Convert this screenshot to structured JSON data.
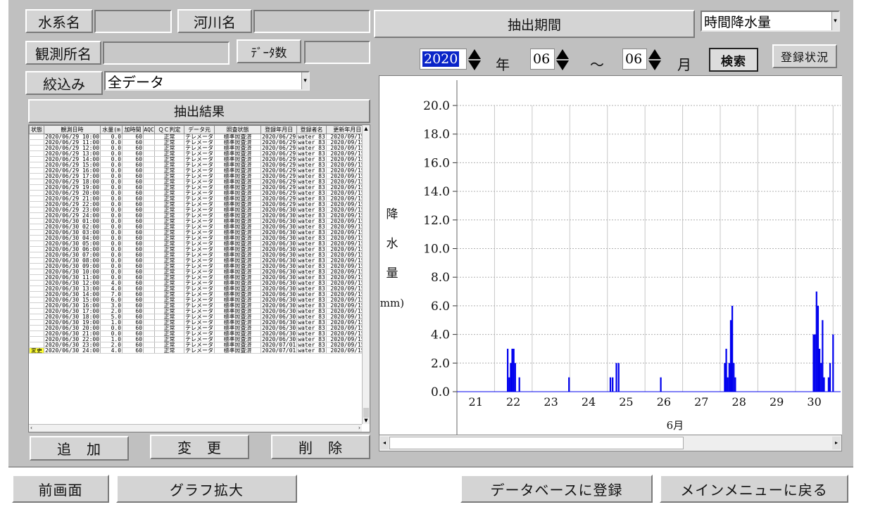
{
  "header": {
    "river_system_label": "水系名",
    "river_system_value": "",
    "river_label": "河川名",
    "river_value": "",
    "station_label": "観測所名",
    "station_value": "",
    "count_label": "ﾃﾞｰﾀ数",
    "count_value": "",
    "filter_label": "絞込み",
    "filter_value": "全データ",
    "result_title": "抽出結果"
  },
  "period": {
    "title": "抽出期間",
    "type_value": "時間降水量",
    "year": "2020",
    "year_unit": "年",
    "month_from": "06",
    "tilde": "～",
    "month_to": "06",
    "month_unit": "月",
    "search_button": "検索",
    "status_button": "登録状況"
  },
  "table": {
    "columns": [
      "状態",
      "観測日時",
      "水量(m",
      "加時間",
      "AQC",
      "ＱＣ判定",
      "データ元",
      "照査状態",
      "登録年月日",
      "登録者名",
      "更新年月日"
    ],
    "rows": [
      [
        "",
        "2020/06/29 10:00",
        "0.0",
        "60",
        "",
        "正常",
        "テレメータ",
        "標準照査済",
        "2020/06/29",
        "water_83",
        "2020/09/15"
      ],
      [
        "",
        "2020/06/29 11:00",
        "0.0",
        "60",
        "",
        "正常",
        "テレメータ",
        "標準照査済",
        "2020/06/29",
        "water_83",
        "2020/09/15"
      ],
      [
        "",
        "2020/06/29 12:00",
        "0.0",
        "60",
        "",
        "正常",
        "テレメータ",
        "標準照査済",
        "2020/06/29",
        "water_83",
        "2020/09/15"
      ],
      [
        "",
        "2020/06/29 13:00",
        "0.0",
        "60",
        "",
        "正常",
        "テレメータ",
        "標準照査済",
        "2020/06/29",
        "water_83",
        "2020/09/15"
      ],
      [
        "",
        "2020/06/29 14:00",
        "0.0",
        "60",
        "",
        "正常",
        "テレメータ",
        "標準照査済",
        "2020/06/29",
        "water_83",
        "2020/09/15"
      ],
      [
        "",
        "2020/06/29 15:00",
        "0.0",
        "60",
        "",
        "正常",
        "テレメータ",
        "標準照査済",
        "2020/06/29",
        "water_83",
        "2020/09/15"
      ],
      [
        "",
        "2020/06/29 16:00",
        "0.0",
        "60",
        "",
        "正常",
        "テレメータ",
        "標準照査済",
        "2020/06/29",
        "water_83",
        "2020/09/15"
      ],
      [
        "",
        "2020/06/29 17:00",
        "0.0",
        "60",
        "",
        "正常",
        "テレメータ",
        "標準照査済",
        "2020/06/29",
        "water_83",
        "2020/09/15"
      ],
      [
        "",
        "2020/06/29 18:00",
        "0.0",
        "60",
        "",
        "正常",
        "テレメータ",
        "標準照査済",
        "2020/06/29",
        "water_83",
        "2020/09/15"
      ],
      [
        "",
        "2020/06/29 19:00",
        "0.0",
        "60",
        "",
        "正常",
        "テレメータ",
        "標準照査済",
        "2020/06/29",
        "water_83",
        "2020/09/15"
      ],
      [
        "",
        "2020/06/29 20:00",
        "0.0",
        "60",
        "",
        "正常",
        "テレメータ",
        "標準照査済",
        "2020/06/29",
        "water_83",
        "2020/09/15"
      ],
      [
        "",
        "2020/06/29 21:00",
        "0.0",
        "60",
        "",
        "正常",
        "テレメータ",
        "標準照査済",
        "2020/06/29",
        "water_83",
        "2020/09/15"
      ],
      [
        "",
        "2020/06/29 22:00",
        "0.0",
        "60",
        "",
        "正常",
        "テレメータ",
        "標準照査済",
        "2020/06/29",
        "water_83",
        "2020/09/15"
      ],
      [
        "",
        "2020/06/29 23:00",
        "0.0",
        "60",
        "",
        "正常",
        "テレメータ",
        "標準照査済",
        "2020/06/30",
        "water_83",
        "2020/09/15"
      ],
      [
        "",
        "2020/06/29 24:00",
        "0.0",
        "60",
        "",
        "正常",
        "テレメータ",
        "標準照査済",
        "2020/06/30",
        "water_83",
        "2020/09/15"
      ],
      [
        "",
        "2020/06/30 01:00",
        "0.0",
        "60",
        "",
        "正常",
        "テレメータ",
        "標準照査済",
        "2020/06/30",
        "water_83",
        "2020/09/15"
      ],
      [
        "",
        "2020/06/30 02:00",
        "0.0",
        "60",
        "",
        "正常",
        "テレメータ",
        "標準照査済",
        "2020/06/30",
        "water_83",
        "2020/09/15"
      ],
      [
        "",
        "2020/06/30 03:00",
        "0.0",
        "60",
        "",
        "正常",
        "テレメータ",
        "標準照査済",
        "2020/06/30",
        "water_83",
        "2020/09/15"
      ],
      [
        "",
        "2020/06/30 04:00",
        "0.0",
        "60",
        "",
        "正常",
        "テレメータ",
        "標準照査済",
        "2020/06/30",
        "water_83",
        "2020/09/15"
      ],
      [
        "",
        "2020/06/30 05:00",
        "0.0",
        "60",
        "",
        "正常",
        "テレメータ",
        "標準照査済",
        "2020/06/30",
        "water_83",
        "2020/09/15"
      ],
      [
        "",
        "2020/06/30 06:00",
        "0.0",
        "60",
        "",
        "正常",
        "テレメータ",
        "標準照査済",
        "2020/06/30",
        "water_83",
        "2020/09/15"
      ],
      [
        "",
        "2020/06/30 07:00",
        "0.0",
        "60",
        "",
        "正常",
        "テレメータ",
        "標準照査済",
        "2020/06/30",
        "water_83",
        "2020/09/15"
      ],
      [
        "",
        "2020/06/30 08:00",
        "0.0",
        "60",
        "",
        "正常",
        "テレメータ",
        "標準照査済",
        "2020/06/30",
        "water_83",
        "2020/09/15"
      ],
      [
        "",
        "2020/06/30 09:00",
        "0.0",
        "60",
        "",
        "正常",
        "テレメータ",
        "標準照査済",
        "2020/06/30",
        "water_83",
        "2020/09/15"
      ],
      [
        "",
        "2020/06/30 10:00",
        "0.0",
        "60",
        "",
        "正常",
        "テレメータ",
        "標準照査済",
        "2020/06/30",
        "water_83",
        "2020/09/15"
      ],
      [
        "",
        "2020/06/30 11:00",
        "0.0",
        "60",
        "",
        "正常",
        "テレメータ",
        "標準照査済",
        "2020/06/30",
        "water_83",
        "2020/09/15"
      ],
      [
        "",
        "2020/06/30 12:00",
        "4.0",
        "60",
        "",
        "正常",
        "テレメータ",
        "標準照査済",
        "2020/06/30",
        "water_83",
        "2020/09/15"
      ],
      [
        "",
        "2020/06/30 13:00",
        "4.0",
        "60",
        "",
        "正常",
        "テレメータ",
        "標準照査済",
        "2020/06/30",
        "water_83",
        "2020/09/15"
      ],
      [
        "",
        "2020/06/30 14:00",
        "7.0",
        "60",
        "",
        "正常",
        "テレメータ",
        "標準照査済",
        "2020/06/30",
        "water_83",
        "2020/09/15"
      ],
      [
        "",
        "2020/06/30 15:00",
        "6.0",
        "60",
        "",
        "正常",
        "テレメータ",
        "標準照査済",
        "2020/06/30",
        "water_83",
        "2020/09/15"
      ],
      [
        "",
        "2020/06/30 16:00",
        "3.0",
        "60",
        "",
        "正常",
        "テレメータ",
        "標準照査済",
        "2020/06/30",
        "water_83",
        "2020/09/15"
      ],
      [
        "",
        "2020/06/30 17:00",
        "2.0",
        "60",
        "",
        "正常",
        "テレメータ",
        "標準照査済",
        "2020/06/30",
        "water_83",
        "2020/09/15"
      ],
      [
        "",
        "2020/06/30 18:00",
        "5.0",
        "60",
        "",
        "正常",
        "テレメータ",
        "標準照査済",
        "2020/06/30",
        "water_83",
        "2020/09/15"
      ],
      [
        "",
        "2020/06/30 19:00",
        "1.0",
        "60",
        "",
        "正常",
        "テレメータ",
        "標準照査済",
        "2020/06/30",
        "water_83",
        "2020/09/15"
      ],
      [
        "",
        "2020/06/30 20:00",
        "0.0",
        "60",
        "",
        "正常",
        "テレメータ",
        "標準照査済",
        "2020/06/30",
        "water_83",
        "2020/09/15"
      ],
      [
        "",
        "2020/06/30 21:00",
        "0.0",
        "60",
        "",
        "正常",
        "テレメータ",
        "標準照査済",
        "2020/06/30",
        "water_83",
        "2020/09/15"
      ],
      [
        "",
        "2020/06/30 22:00",
        "1.0",
        "60",
        "",
        "正常",
        "テレメータ",
        "標準照査済",
        "2020/06/30",
        "water_83",
        "2020/09/15"
      ],
      [
        "",
        "2020/06/30 23:00",
        "2.0",
        "60",
        "",
        "正常",
        "テレメータ",
        "標準照査済",
        "2020/07/01",
        "water_83",
        "2020/09/15"
      ],
      [
        "変更",
        "2020/06/30 24:00",
        "4.0",
        "60",
        "",
        "正常",
        "テレメータ",
        "標準照査済",
        "2020/07/01",
        "water_83",
        "2020/09/15"
      ]
    ]
  },
  "actions": {
    "add": "追　加",
    "change": "変　更",
    "delete": "削　除"
  },
  "footer": {
    "prev": "前画面",
    "graph_zoom": "グラフ拡大",
    "register_db": "データベースに登録",
    "back_main": "メインメニューに戻る"
  },
  "chart_data": {
    "type": "bar",
    "title": "",
    "ylabel": "降水量(mm)",
    "xlabel": "6月",
    "ylim": [
      0,
      20
    ],
    "yticks": [
      "0.0",
      "2.0",
      "4.0",
      "6.0",
      "8.0",
      "10.0",
      "12.0",
      "14.0",
      "16.0",
      "18.0",
      "20.0"
    ],
    "xticks": [
      "21",
      "22",
      "23",
      "24",
      "25",
      "26",
      "27",
      "28",
      "29",
      "30"
    ],
    "x_range_days": [
      20.5,
      30.7
    ],
    "grid": true,
    "color": "#0000ee",
    "bars": [
      {
        "day": 21.85,
        "value": 3.0
      },
      {
        "day": 21.89,
        "value": 1.0
      },
      {
        "day": 21.93,
        "value": 2.0
      },
      {
        "day": 21.97,
        "value": 3.0
      },
      {
        "day": 22.01,
        "value": 3.0
      },
      {
        "day": 22.05,
        "value": 2.0
      },
      {
        "day": 22.16,
        "value": 1.0
      },
      {
        "day": 23.48,
        "value": 1.0
      },
      {
        "day": 24.58,
        "value": 1.0
      },
      {
        "day": 24.64,
        "value": 1.0
      },
      {
        "day": 24.74,
        "value": 2.0
      },
      {
        "day": 24.8,
        "value": 2.0
      },
      {
        "day": 25.92,
        "value": 1.0
      },
      {
        "day": 27.62,
        "value": 2.0
      },
      {
        "day": 27.66,
        "value": 3.0
      },
      {
        "day": 27.7,
        "value": 1.0
      },
      {
        "day": 27.74,
        "value": 2.0
      },
      {
        "day": 27.78,
        "value": 5.0
      },
      {
        "day": 27.82,
        "value": 6.0
      },
      {
        "day": 27.86,
        "value": 2.0
      },
      {
        "day": 27.9,
        "value": 1.0
      },
      {
        "day": 29.98,
        "value": 4.0
      },
      {
        "day": 30.02,
        "value": 4.0
      },
      {
        "day": 30.06,
        "value": 7.0
      },
      {
        "day": 30.1,
        "value": 6.0
      },
      {
        "day": 30.14,
        "value": 3.0
      },
      {
        "day": 30.18,
        "value": 2.0
      },
      {
        "day": 30.22,
        "value": 5.0
      },
      {
        "day": 30.26,
        "value": 1.0
      },
      {
        "day": 30.38,
        "value": 1.0
      },
      {
        "day": 30.42,
        "value": 2.0
      },
      {
        "day": 30.5,
        "value": 4.0
      }
    ]
  }
}
